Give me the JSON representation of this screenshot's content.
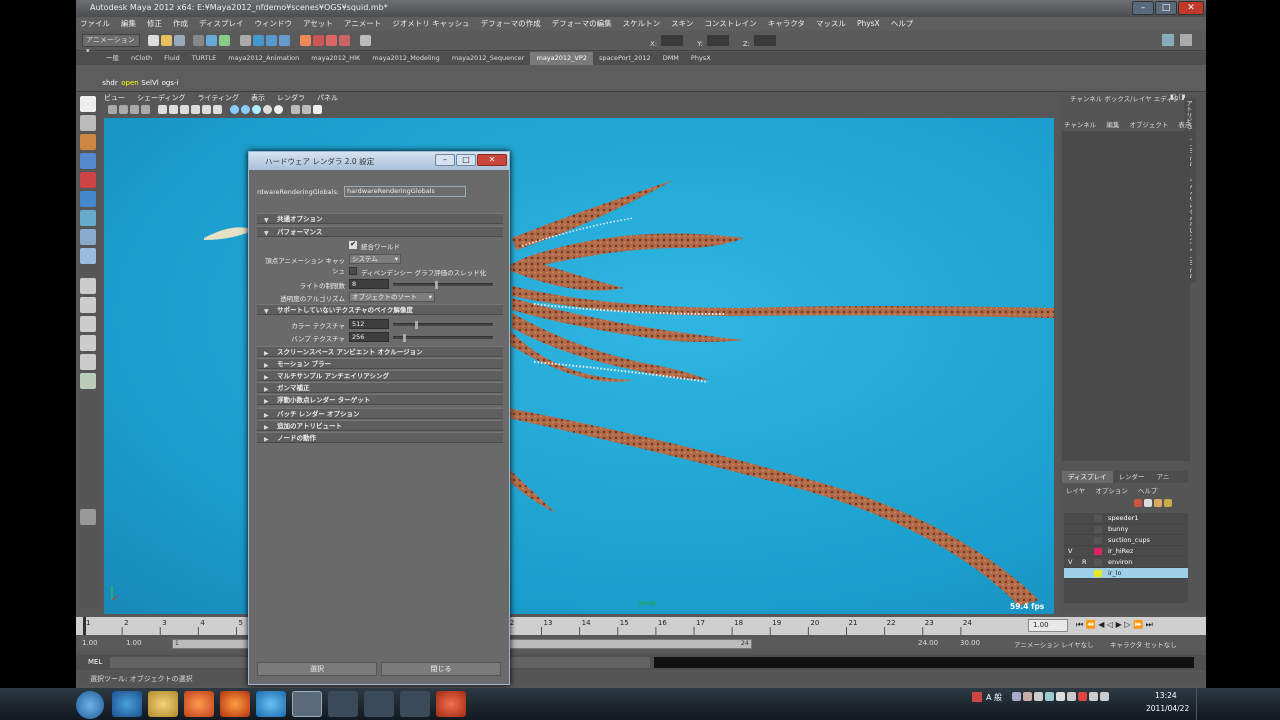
{
  "app": {
    "title": "Autodesk Maya 2012 x64: E:¥Maya2012_nfdemo¥scenes¥OGS¥squid.mb*"
  },
  "menu": [
    "ファイル",
    "編集",
    "修正",
    "作成",
    "ディスプレイ",
    "ウィンドウ",
    "アセット",
    "アニメート",
    "ジオメトリ キャッシュ",
    "デフォーマの作成",
    "デフォーマの編集",
    "スケルトン",
    "スキン",
    "コンストレイン",
    "キャラクタ",
    "マッスル",
    "PhysX",
    "ヘルプ"
  ],
  "status": {
    "mode": "アニメーション",
    "x_label": "X:",
    "y_label": "Y:",
    "z_label": "Z:"
  },
  "shelf_tabs": [
    "一般",
    "nCloth",
    "Fluid",
    "TURTLE",
    "maya2012_Animation",
    "maya2012_HIK",
    "maya2012_Modeling",
    "maya2012_Sequencer",
    "maya2012_VP2",
    "spacePort_2012",
    "DMM",
    "PhysX"
  ],
  "shelf_active": "maya2012_VP2",
  "shelf_buttons": [
    "shdr",
    "open",
    "SelVl",
    "ogs-i"
  ],
  "panel_menu": [
    "ビュー",
    "シェーディング",
    "ライティング",
    "表示",
    "レンダラ",
    "パネル"
  ],
  "viewport": {
    "camera": "persp",
    "fps": "59.4 fps"
  },
  "channel_box": {
    "title": "チャンネル ボックス/レイヤ エディタ",
    "menu": [
      "チャンネル",
      "編集",
      "オブジェクト",
      "表示"
    ],
    "side_tabs": [
      "アトリビュート エディタ",
      "チャンネル ボックス/レイヤ エディタ"
    ]
  },
  "layer_editor": {
    "tabs": [
      "ディスプレイ",
      "レンダー",
      "アニ"
    ],
    "menu": [
      "レイヤ",
      "オプション",
      "ヘルプ"
    ],
    "layers": [
      {
        "v": "",
        "r": "",
        "name": "speeder1",
        "color": ""
      },
      {
        "v": "",
        "r": "",
        "name": "bunny",
        "color": ""
      },
      {
        "v": "",
        "r": "",
        "name": "suction_cups",
        "color": ""
      },
      {
        "v": "V",
        "r": "",
        "name": "ir_hiRez",
        "color": "#e0206a"
      },
      {
        "v": "V",
        "r": "R",
        "name": "environ",
        "color": ""
      },
      {
        "v": "",
        "r": "",
        "name": "ir_lo",
        "color": "#e8e820"
      }
    ]
  },
  "timeline": {
    "ticks": [
      "1",
      "2",
      "3",
      "4",
      "5",
      "6",
      "7",
      "8",
      "9",
      "10",
      "11",
      "12",
      "13",
      "14",
      "15",
      "16",
      "17",
      "18",
      "19",
      "20",
      "21",
      "22",
      "23",
      "24"
    ],
    "current": "1.00"
  },
  "range": {
    "start": "1.00",
    "inner_start": "1.00",
    "marker_1": "1",
    "marker_24": "24",
    "end": "24.00",
    "anim_end": "30.00",
    "anim_layer": "アニメーション レイヤなし",
    "char_set": "キャラクタ セットなし"
  },
  "mel": {
    "label": "MEL"
  },
  "help_line": "選択ツール: オブジェクトの選択",
  "dialog": {
    "title": "ハードウェア レンダラ 2.0 設定",
    "globals_label": "rdwareRenderingGlobals:",
    "globals_value": "hardwareRenderingGlobals",
    "sections": [
      "共通オプション",
      "パフォーマンス",
      "サポートしていないテクスチャのベイク解像度",
      "スクリーンスペース アンビエント オクルージョン",
      "モーション ブラー",
      "マルチサンプル アンチエイリアシング",
      "ガンマ補正",
      "浮動小数点レンダー ターゲット",
      "バッチ レンダー オプション",
      "追加のアトリビュート",
      "ノードの動作"
    ],
    "consolidate": "統合ワールド",
    "vertex_cache_label": "頂点アニメーション キャッシュ",
    "vertex_cache_value": "システム",
    "dependency": "ディペンデンシー グラフ評価のスレッド化",
    "light_limit_label": "ライトの制限数",
    "light_limit": "8",
    "transparency_label": "透明度のアルゴリズム",
    "transparency_value": "オブジェクトのソート",
    "color_tex_label": "カラー テクスチャ",
    "color_tex": "512",
    "bump_tex_label": "バンプ テクスチャ",
    "bump_tex": "256",
    "select_btn": "選択",
    "close_btn": "閉じる"
  },
  "taskbar": {
    "ime": "A 般",
    "time": "13:24",
    "date": "2011/04/22"
  }
}
